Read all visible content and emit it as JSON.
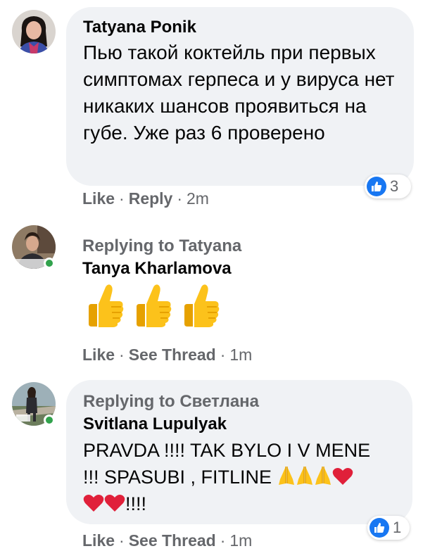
{
  "comments": [
    {
      "author": "Tatyana Ponik",
      "text": "Пью такой коктейль при первых симптомах герпеса и у вируса нет никаких шансов проявиться на губе. Уже раз 6 проверено",
      "actions": {
        "like": "Like",
        "reply": "Reply",
        "time": "2m"
      },
      "reaction_count": "3",
      "online": false
    },
    {
      "replying_to": "Replying to Tatyana",
      "author": "Tanya Kharlamova",
      "emojis": [
        "thumbs-up",
        "thumbs-up",
        "thumbs-up"
      ],
      "actions": {
        "like": "Like",
        "thread": "See Thread",
        "time": "1m"
      },
      "online": true
    },
    {
      "replying_to": "Replying to Светлана",
      "author": "Svitlana Lupulyak",
      "text_line1": "PRAVDA !!!! TAK BYLO I V MENE",
      "text_line2": "!!! SPASUBI , FITLINE",
      "text_line3_suffix": "!!!!",
      "actions": {
        "like": "Like",
        "thread": "See Thread",
        "time": "1m"
      },
      "reaction_count": "1",
      "online": true
    }
  ],
  "separator": "·",
  "colors": {
    "bubble": "#f0f2f5",
    "secondary_text": "#65676b",
    "like_blue": "#1877f2",
    "online_green": "#31a24c"
  }
}
